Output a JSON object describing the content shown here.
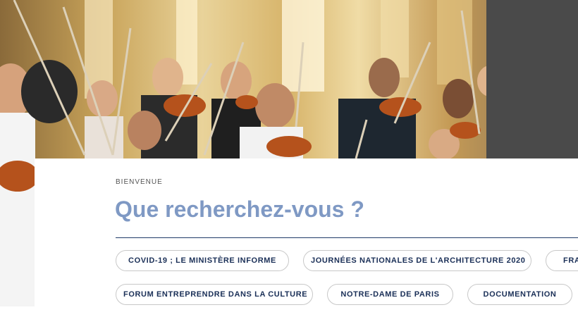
{
  "hero": {
    "image_description_icon": "orchestra-photo-icon",
    "palette": {
      "wall": "#e9d39a",
      "skin": "#e0b48c",
      "violin": "#b5521c",
      "dark": "#2a2a2a"
    }
  },
  "welcome": {
    "eyebrow": "BIENVENUE",
    "title": "Que recherchez-vous ?"
  },
  "chips": {
    "row1": [
      "COVID-19 ; LE MINISTÈRE INFORME",
      "JOURNÉES NATIONALES DE L'ARCHITECTURE 2020",
      "FRA"
    ],
    "row2": [
      "FORUM ENTREPRENDRE DANS LA CULTURE",
      "NOTRE-DAME DE PARIS",
      "DOCUMENTATION"
    ]
  },
  "colors": {
    "title": "#7f99c4",
    "chip_text": "#1a2f57",
    "rule": "#1f3a68"
  }
}
